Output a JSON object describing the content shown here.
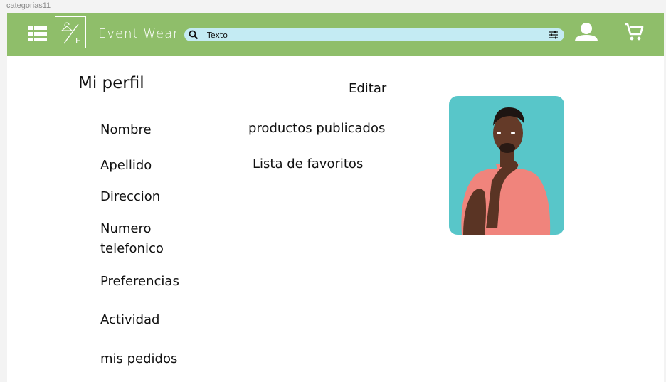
{
  "frame_label": "categorias11",
  "header": {
    "brand": "Event Wear",
    "logo_letter": "E",
    "search": {
      "value": "Texto"
    },
    "colors": {
      "header_bg": "#8fbe6a",
      "search_bg": "#c4ebf3"
    },
    "icons": [
      "menu-icon",
      "logo",
      "search-icon",
      "filter-icon",
      "user-icon",
      "cart-icon"
    ]
  },
  "profile": {
    "title": "Mi perfil",
    "edit_label": "Editar",
    "fields": {
      "nombre": "Nombre",
      "apellido": "Apellido",
      "direccion": "Direccion",
      "telefono_line1": "Numero",
      "telefono_line2": "telefonico",
      "preferencias": "Preferencias",
      "actividad": "Actividad",
      "pedidos": "mis pedidos"
    },
    "links": {
      "productos": "productos publicados",
      "favoritos": "Lista de favoritos"
    },
    "photo_bg": "#58c6c9"
  }
}
